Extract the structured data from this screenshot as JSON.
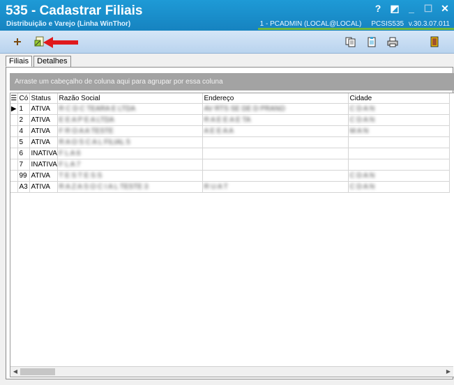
{
  "window": {
    "title": "535 - Cadastrar Filiais",
    "subtitle": "Distribuição e Varejo (Linha WinThor)",
    "connection": "1 - PCADMIN (LOCAL@LOCAL)",
    "program": "PCSIS535",
    "version": "v.30.3.07.011",
    "buttons": {
      "help": "?",
      "restore": "◩",
      "minimize": "_",
      "maximize": "☐",
      "close": "✕"
    }
  },
  "toolbar": {
    "icons": [
      "add-icon",
      "edit-document-icon",
      "copy-icon",
      "clipboard-icon",
      "print-icon",
      "exit-icon"
    ],
    "accent": "#1683c0",
    "arrow_color": "#e0191c"
  },
  "tabs": [
    "Filiais",
    "Detalhes"
  ],
  "grid": {
    "group_hint": "Arraste um cabeçalho de coluna aqui para agrupar por essa coluna",
    "columns": [
      "Có",
      "Status",
      "Razão Social",
      "Endereço",
      "Cidade"
    ],
    "rows": [
      {
        "code": "1",
        "status": "ATIVA",
        "razao": "R C D C TEARA E LTDA",
        "endereco": "AV RTS SE DE D PRANO",
        "cidade": "C D A N"
      },
      {
        "code": "2",
        "status": "ATIVA",
        "razao": "E E A P E A LTDA",
        "endereco": "R A E E A E TA",
        "cidade": "C D A N"
      },
      {
        "code": "4",
        "status": "ATIVA",
        "razao": "F R O A A TESTE",
        "endereco": "A E E A A",
        "cidade": "M A N"
      },
      {
        "code": "5",
        "status": "ATIVA",
        "razao": "R A O S C A L FILIAL 5",
        "endereco": "",
        "cidade": ""
      },
      {
        "code": "6",
        "status": "INATIVA",
        "razao": "F L A 6",
        "endereco": "",
        "cidade": ""
      },
      {
        "code": "7",
        "status": "INATIVA",
        "razao": "F L A 7",
        "endereco": "",
        "cidade": ""
      },
      {
        "code": "99",
        "status": "ATIVA",
        "razao": "T E S T E S S",
        "endereco": "",
        "cidade": "C D A N"
      },
      {
        "code": "A3",
        "status": "ATIVA",
        "razao": "R A Z A S O C I A L TESTE 3",
        "endereco": "R U A T",
        "cidade": "C D A N"
      }
    ]
  }
}
